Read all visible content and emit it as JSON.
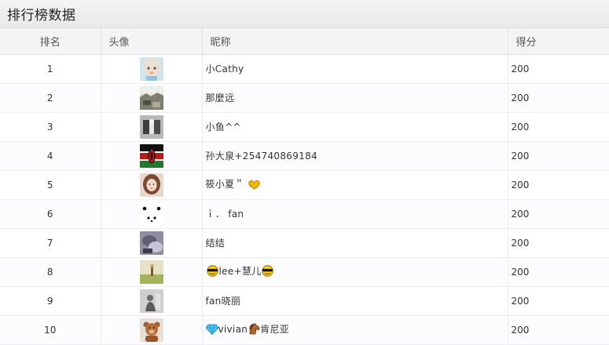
{
  "panel": {
    "title": "排行榜数据"
  },
  "table": {
    "headers": {
      "rank": "排名",
      "avatar": "头像",
      "nickname": "昵称",
      "score": "得分"
    },
    "rows": [
      {
        "rank": "1",
        "nickname": "小Cathy",
        "score": "200",
        "avatar_icon": "baby-avatar-icon"
      },
      {
        "rank": "2",
        "nickname": "那麼远",
        "score": "200",
        "avatar_icon": "landscape-photo-avatar-icon"
      },
      {
        "rank": "3",
        "nickname": "小鱼^^",
        "score": "200",
        "avatar_icon": "grayscale-photo-avatar-icon"
      },
      {
        "rank": "4",
        "nickname": "孙大泉+254740869184",
        "score": "200",
        "avatar_icon": "kenya-flag-avatar-icon"
      },
      {
        "rank": "5",
        "nickname": "筱小夏＂",
        "score": "200",
        "avatar_icon": "girl-portrait-avatar-icon",
        "suffix_emoji": "heart-hands-emoji-icon"
      },
      {
        "rank": "6",
        "nickname": "ｉ． fan",
        "score": "200",
        "avatar_icon": "panda-dots-avatar-icon"
      },
      {
        "rank": "7",
        "nickname": "结结",
        "score": "200",
        "avatar_icon": "blurred-photo-avatar-icon"
      },
      {
        "rank": "8",
        "nickname": "lee+慧儿",
        "score": "200",
        "avatar_icon": "field-photo-avatar-icon",
        "prefix_emoji": "sunglasses-emoji-icon",
        "suffix_emoji": "sunglasses-emoji-icon"
      },
      {
        "rank": "9",
        "nickname": "fan晓丽",
        "score": "200",
        "avatar_icon": "person-gray-avatar-icon"
      },
      {
        "rank": "10",
        "nickname": "vivian",
        "score": "200",
        "avatar_icon": "teddy-bear-avatar-icon",
        "prefix_emoji": "gem-emoji-icon",
        "mid_emoji": "horse-emoji-icon",
        "nickname_tail": "肯尼亚"
      }
    ]
  },
  "colors": {
    "header_bg": "#f4f4f4",
    "title_bar_bg": "#ececec",
    "text": "#333333"
  }
}
